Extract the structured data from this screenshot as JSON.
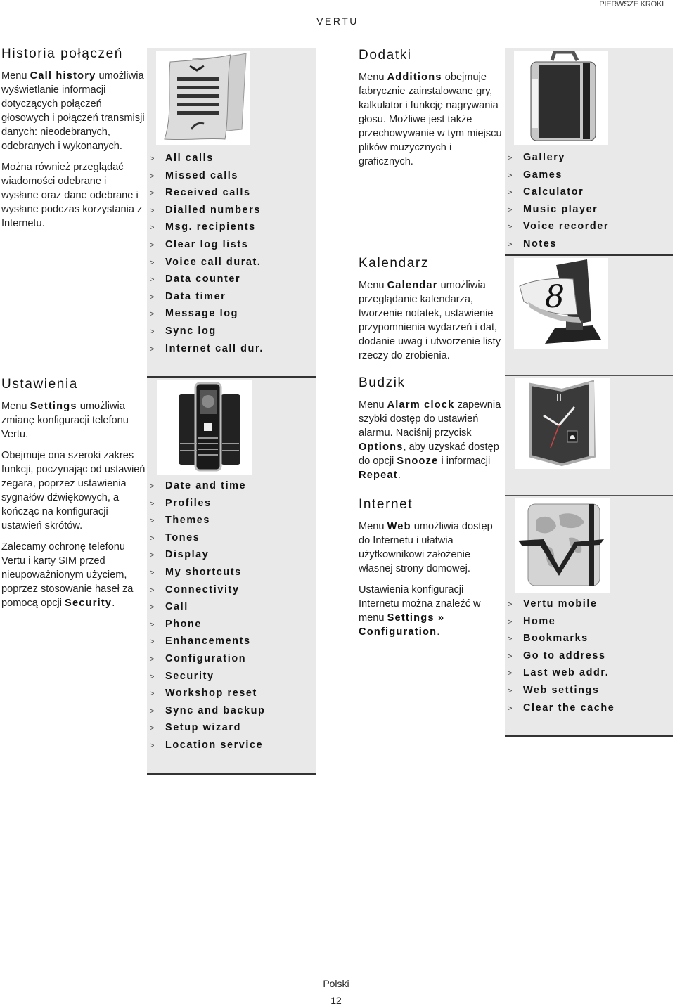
{
  "header": {
    "running_head": "PIERWSZE KROKI",
    "brand": "VERTU"
  },
  "sections": {
    "call_history": {
      "title": "Historia połączeń",
      "p1": {
        "pre": "Menu ",
        "bold": "Call history",
        "post": " umożliwia wyświetlanie informacji dotyczących połączeń głosowych i połączeń transmisji danych: nieodebranych, odebranych i wykonanych."
      },
      "p2": "Można również przeglądać wiadomości odebrane i wysłane oraz dane odebrane i wysłane podczas korzystania z Internetu.",
      "image_icon": "call-log-scroll-icon",
      "menu": [
        "All calls",
        "Missed calls",
        "Received calls",
        "Dialled numbers",
        "Msg. recipients",
        "Clear log lists",
        "Voice call durat.",
        "Data counter",
        "Data timer",
        "Message log",
        "Sync log",
        "Internet call dur."
      ]
    },
    "settings": {
      "title": "Ustawienia",
      "p1": {
        "pre": "Menu ",
        "bold": "Settings",
        "post": " umożliwia zmianę konfiguracji telefonu Vertu."
      },
      "p2": "Obejmuje ona szeroki zakres funkcji, poczynając od ustawień zegara, poprzez ustawienia sygnałów dźwiękowych, a kończąc na konfiguracji ustawień skrótów.",
      "p3": {
        "pre": "Zalecamy ochronę telefonu Vertu i karty SIM przed nieupoważnionym użyciem, poprzez stosowanie haseł za pomocą opcji ",
        "bold": "Security",
        "post": "."
      },
      "image_icon": "vertu-phones-icon",
      "menu": [
        "Date and time",
        "Profiles",
        "Themes",
        "Tones",
        "Display",
        "My shortcuts",
        "Connectivity",
        "Call",
        "Phone",
        "Enhancements",
        "Configuration",
        "Security",
        "Workshop reset",
        "Sync and backup",
        "Setup wizard",
        "Location service"
      ]
    },
    "additions": {
      "title": "Dodatki",
      "p1": {
        "pre": "Menu ",
        "bold": "Additions",
        "post": " obejmuje fabrycznie zainstalowane gry, kalkulator i funkcję nagrywania głosu. Możliwe jest także przechowywanie w tym miejscu plików muzycznych i graficznych."
      },
      "image_icon": "briefcase-icon",
      "menu": [
        "Gallery",
        "Games",
        "Calculator",
        "Music player",
        "Voice recorder",
        "Notes"
      ]
    },
    "calendar": {
      "title": "Kalendarz",
      "p1": {
        "pre": "Menu ",
        "bold": "Calendar",
        "post": " umożliwia przeglądanie kalendarza, tworzenie notatek, ustawienie przypomnienia wydarzeń i dat, dodanie uwag i utworzenie listy rzeczy do zrobienia."
      },
      "image_icon": "desk-calendar-icon"
    },
    "alarm": {
      "title": "Budzik",
      "p1": {
        "pre": "Menu ",
        "bold": "Alarm clock",
        "mid1": " zapewnia szybki dostęp do ustawień alarmu. Naciśnij przycisk ",
        "bold2": "Options",
        "mid2": ", aby uzyskać dostęp do opcji ",
        "bold3": "Snooze",
        "mid3": " i informacji ",
        "bold4": "Repeat",
        "post": "."
      },
      "image_icon": "alarm-clock-icon"
    },
    "internet": {
      "title": "Internet",
      "p1": {
        "pre": "Menu ",
        "bold": "Web",
        "post": " umożliwia dostęp do Internetu i ułatwia użytkownikowi założenie własnej strony domowej."
      },
      "p2": {
        "pre": "Ustawienia konfiguracji Internetu można znaleźć w menu ",
        "bold": "Settings »",
        "mid": " ",
        "bold2": "Configuration",
        "post": "."
      },
      "image_icon": "globe-v-icon",
      "menu": [
        "Vertu mobile",
        "Home",
        "Bookmarks",
        "Go to address",
        "Last web addr.",
        "Web settings",
        "Clear the cache"
      ]
    }
  },
  "menu_arrow": ">",
  "footer": {
    "language": "Polski",
    "page_number": "12"
  }
}
